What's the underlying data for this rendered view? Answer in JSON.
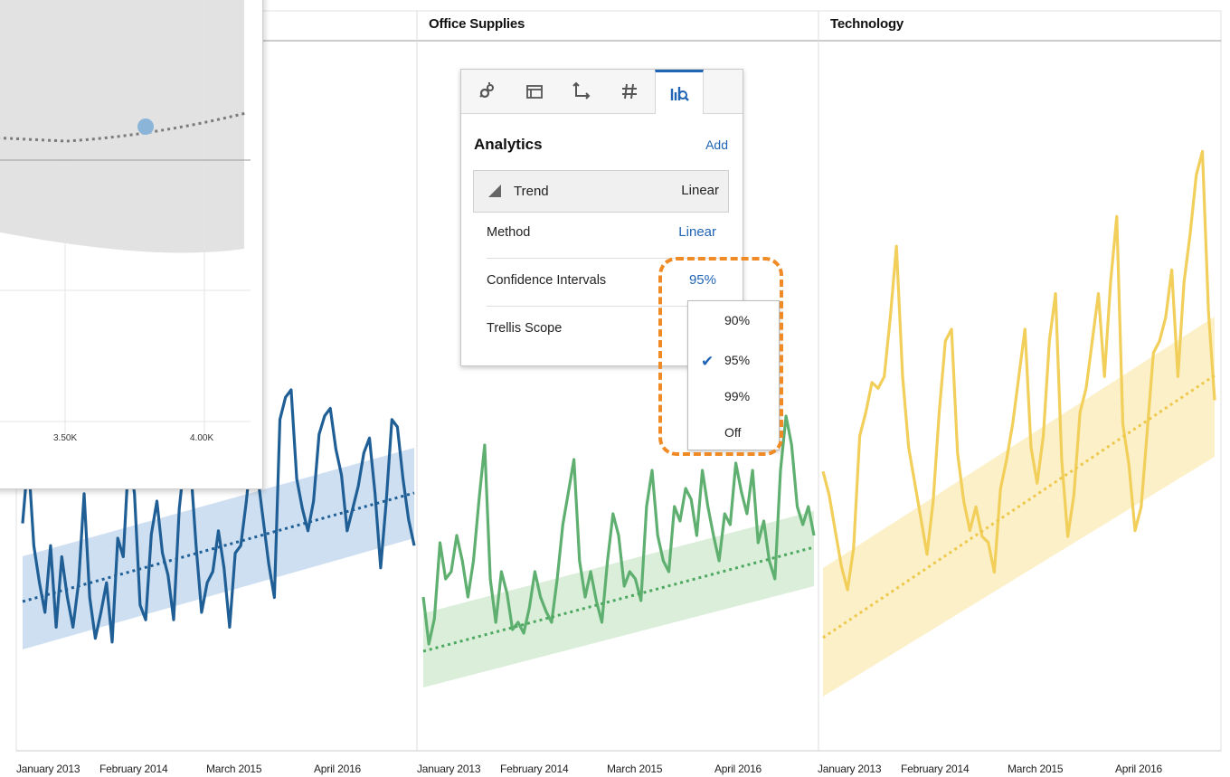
{
  "panels": [
    {
      "header": "",
      "color": "#1f5f96",
      "band": "#c9dcef",
      "trend": "#1f5f96"
    },
    {
      "header": "Office Supplies",
      "color": "#5fb070",
      "band": "#d6ecd6",
      "trend": "#4da860"
    },
    {
      "header": "Technology",
      "color": "#f1cf5a",
      "band": "#fbeec2",
      "trend": "#edc84a"
    }
  ],
  "x_ticks": [
    "January 2013",
    "February 2014",
    "March 2015",
    "April 2016"
  ],
  "overlay": {
    "x_ticks": [
      "3.50K",
      "4.00K"
    ]
  },
  "analytics": {
    "tabs": [
      {
        "icon": "general-icon"
      },
      {
        "icon": "layout-icon"
      },
      {
        "icon": "axis-icon"
      },
      {
        "icon": "number-format-icon"
      },
      {
        "icon": "analytics-icon",
        "active": true
      }
    ],
    "title": "Analytics",
    "add_label": "Add",
    "trend": {
      "label": "Trend",
      "value": "Linear"
    },
    "method": {
      "label": "Method",
      "value": "Linear"
    },
    "confidence": {
      "label": "Confidence Intervals",
      "value": "95%"
    },
    "trellis": {
      "label": "Trellis Scope",
      "value": ""
    }
  },
  "dropdown": {
    "options": [
      {
        "label": "90%",
        "selected": false
      },
      {
        "label": "95%",
        "selected": true
      },
      {
        "label": "99%",
        "selected": false
      },
      {
        "label": "Off",
        "selected": false
      }
    ]
  },
  "chart_data": {
    "type": "line",
    "panels": [
      "",
      "Office Supplies",
      "Technology"
    ],
    "categories": [
      "January 2013",
      "February 2014",
      "March 2015",
      "April 2016"
    ],
    "series": [
      {
        "name": "",
        "values": [
          0.46,
          0.28,
          0.52,
          0.62,
          0.7,
          0.52,
          0.74,
          0.55,
          0.66,
          0.74,
          0.62,
          0.38,
          0.66,
          0.77,
          0.7,
          0.62,
          0.78,
          0.5,
          0.55,
          0.27,
          0.38,
          0.68,
          0.72,
          0.49,
          0.4,
          0.54,
          0.6,
          0.72,
          0.42,
          0.28,
          0.3,
          0.52,
          0.7,
          0.62,
          0.59,
          0.48,
          0.58,
          0.74,
          0.54,
          0.52,
          0.4,
          0.25,
          0.33,
          0.45,
          0.57,
          0.66,
          0.18,
          0.12,
          0.1,
          0.34,
          0.42,
          0.48,
          0.4,
          0.22,
          0.17,
          0.15,
          0.26,
          0.33,
          0.48,
          0.42,
          0.36,
          0.27,
          0.23,
          0.38,
          0.58,
          0.4,
          0.18,
          0.2,
          0.34,
          0.45,
          0.52
        ]
      },
      {
        "name": "Office Supplies",
        "values": [
          0.65,
          0.78,
          0.71,
          0.5,
          0.6,
          0.58,
          0.48,
          0.55,
          0.65,
          0.55,
          0.38,
          0.23,
          0.6,
          0.72,
          0.58,
          0.64,
          0.74,
          0.72,
          0.75,
          0.68,
          0.58,
          0.65,
          0.69,
          0.72,
          0.6,
          0.45,
          0.36,
          0.27,
          0.55,
          0.65,
          0.58,
          0.66,
          0.72,
          0.55,
          0.42,
          0.48,
          0.62,
          0.58,
          0.6,
          0.66,
          0.4,
          0.3,
          0.48,
          0.55,
          0.58,
          0.4,
          0.44,
          0.35,
          0.38,
          0.48,
          0.3,
          0.4,
          0.48,
          0.55,
          0.42,
          0.45,
          0.28,
          0.36,
          0.42,
          0.3,
          0.5,
          0.44,
          0.55,
          0.6,
          0.3,
          0.15,
          0.23,
          0.4,
          0.45,
          0.4,
          0.48
        ]
      },
      {
        "name": "Technology",
        "values": [
          0.62,
          0.66,
          0.72,
          0.78,
          0.82,
          0.75,
          0.56,
          0.52,
          0.47,
          0.48,
          0.46,
          0.36,
          0.24,
          0.46,
          0.58,
          0.64,
          0.7,
          0.76,
          0.67,
          0.52,
          0.4,
          0.38,
          0.59,
          0.67,
          0.72,
          0.68,
          0.73,
          0.74,
          0.79,
          0.65,
          0.6,
          0.54,
          0.46,
          0.38,
          0.58,
          0.64,
          0.56,
          0.4,
          0.32,
          0.6,
          0.73,
          0.66,
          0.52,
          0.48,
          0.4,
          0.32,
          0.46,
          0.3,
          0.19,
          0.54,
          0.61,
          0.72,
          0.68,
          0.55,
          0.42,
          0.4,
          0.36,
          0.28,
          0.46,
          0.3,
          0.22,
          0.12,
          0.08,
          0.35,
          0.5
        ]
      }
    ]
  }
}
